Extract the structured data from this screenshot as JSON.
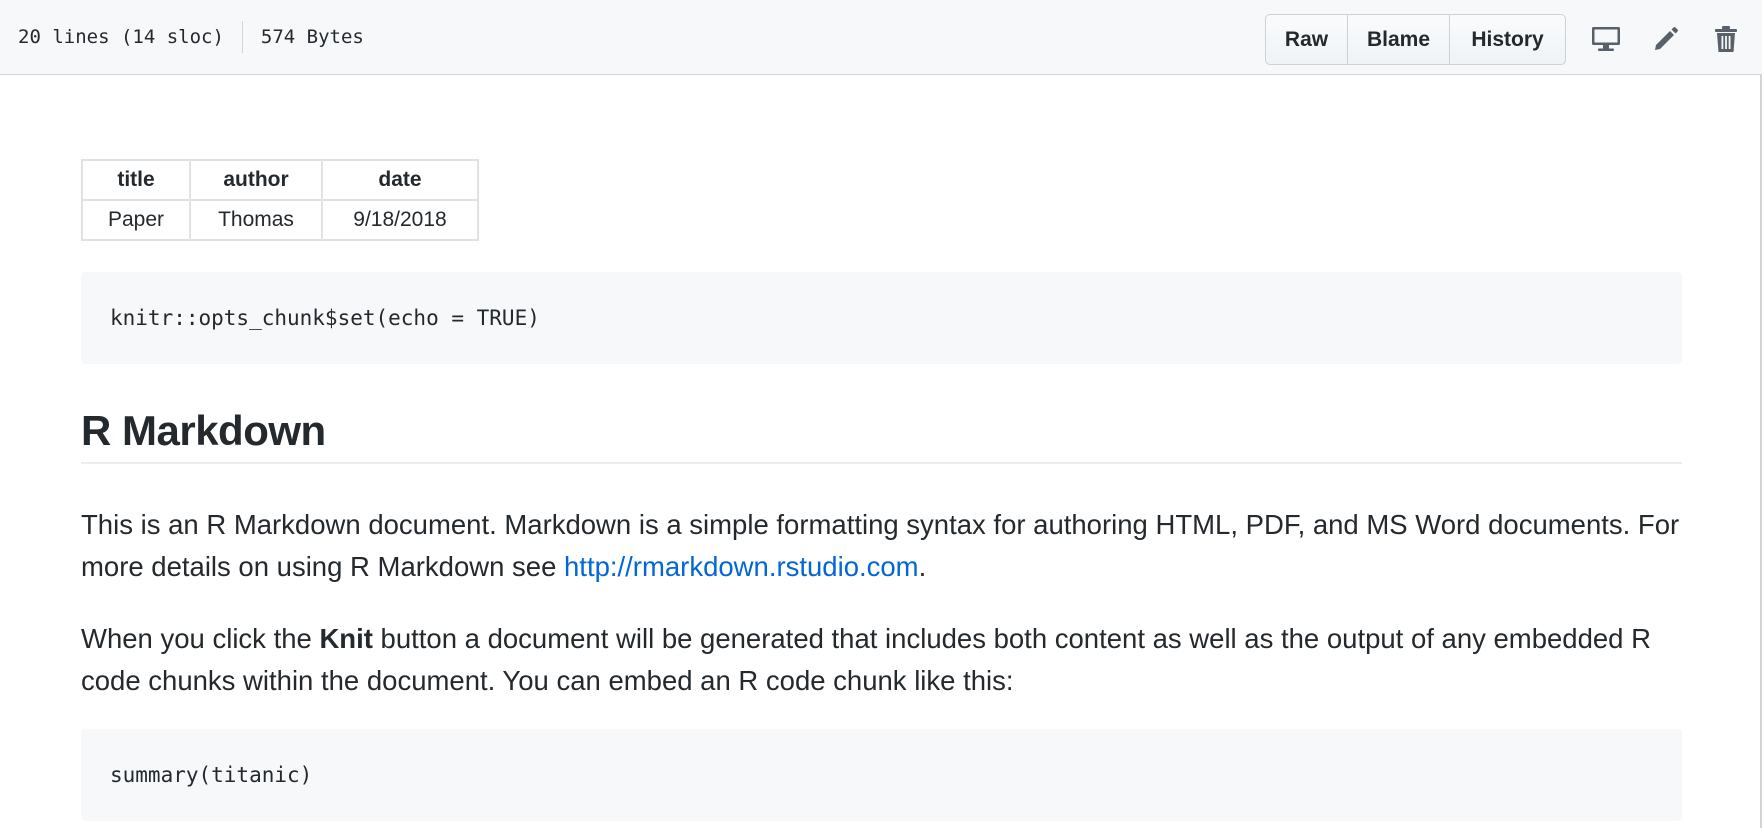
{
  "file_header": {
    "lines_info": "20 lines (14 sloc)",
    "size_info": "574 Bytes",
    "buttons": {
      "raw": "Raw",
      "blame": "Blame",
      "history": "History"
    },
    "icons": [
      "desktop-icon",
      "pencil-icon",
      "trash-icon"
    ]
  },
  "metadata_table": {
    "headers": [
      "title",
      "author",
      "date"
    ],
    "row": [
      "Paper",
      "Thomas",
      "9/18/2018"
    ]
  },
  "code_block_1": "knitr::opts_chunk$set(echo = TRUE)",
  "heading": "R Markdown",
  "paragraph_1": {
    "text": "This is an R Markdown document. Markdown is a simple formatting syntax for authoring HTML, PDF, and MS Word documents. For more details on using R Markdown see ",
    "link_text": "http://rmarkdown.rstudio.com",
    "suffix": "."
  },
  "paragraph_2": {
    "prefix": "When you click the ",
    "bold": "Knit",
    "suffix": " button a document will be generated that includes both content as well as the output of any embedded R code chunks within the document. You can embed an R code chunk like this:"
  },
  "code_block_2": "summary(titanic)",
  "colors": {
    "link": "#0366d6",
    "text": "#24292e",
    "header_bg": "#f6f8fa",
    "code_bg": "#f6f8fa",
    "border": "#d1d5da",
    "icon": "#586069"
  }
}
